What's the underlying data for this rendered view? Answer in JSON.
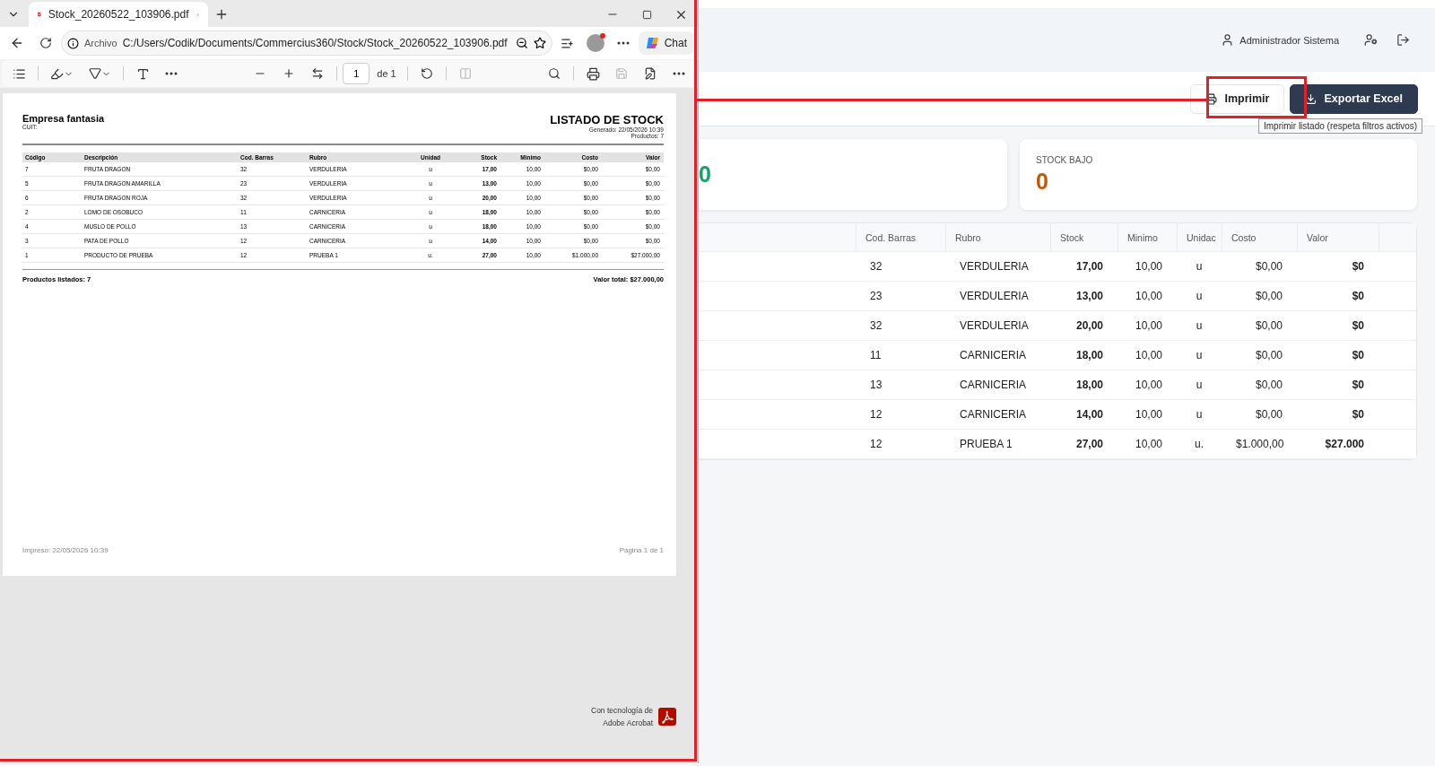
{
  "browser": {
    "tab_title": "Stock_20260522_103906.pdf",
    "address_label": "Archivo",
    "url": "C:/Users/Codik/Documents/Commercius360/Stock/Stock_20260522_103906.pdf",
    "chat_label": "Chat",
    "page_input": "1",
    "page_total": "de 1"
  },
  "pdf": {
    "company": "Empresa fantasia",
    "cuit": "CUIT:",
    "title": "LISTADO DE STOCK",
    "generated": "Generado: 22/05/2026 10:39",
    "count": "Productos: 7",
    "columns": [
      "Código",
      "Descripción",
      "Cod. Barras",
      "Rubro",
      "Unidad",
      "Stock",
      "Minimo",
      "Costo",
      "Valor"
    ],
    "rows": [
      [
        "7",
        "FRUTA DRAGON",
        "32",
        "VERDULERIA",
        "u",
        "17,00",
        "10,00",
        "$0,00",
        "$0,00"
      ],
      [
        "5",
        "FRUTA DRAGON AMARILLA",
        "23",
        "VERDULERIA",
        "u",
        "13,00",
        "10,00",
        "$0,00",
        "$0,00"
      ],
      [
        "6",
        "FRUTA DRAGON ROJA",
        "32",
        "VERDULERIA",
        "u",
        "20,00",
        "10,00",
        "$0,00",
        "$0,00"
      ],
      [
        "2",
        "LOMO DE OSOBUCO",
        "11",
        "CARNICERIA",
        "u",
        "18,00",
        "10,00",
        "$0,00",
        "$0,00"
      ],
      [
        "4",
        "MUSLO DE POLLO",
        "13",
        "CARNICERIA",
        "u",
        "18,00",
        "10,00",
        "$0,00",
        "$0,00"
      ],
      [
        "3",
        "PATA DE POLLO",
        "12",
        "CARNICERIA",
        "u",
        "14,00",
        "10,00",
        "$0,00",
        "$0,00"
      ],
      [
        "1",
        "PRODUCTO DE PRUEBA",
        "12",
        "PRUEBA 1",
        "u.",
        "27,00",
        "10,00",
        "$1.000,00",
        "$27.000,00"
      ]
    ],
    "summary_left": "Productos listados: 7",
    "summary_right": "Valor total: $27.000,00",
    "printed": "Impreso: 22/05/2026 10:39",
    "page_label": "Página 1 de 1",
    "branding": [
      "Con tecnología de",
      "Adobe Acrobat"
    ]
  },
  "app": {
    "user": "Administrador Sistema",
    "buttons": [
      {
        "label": "Imprimir",
        "kind": "outline"
      },
      {
        "label": "Exportar Excel",
        "kind": "primary"
      }
    ],
    "tooltip": "Imprimir listado (respeta filtros activos)",
    "cards": [
      {
        "value": "0",
        "color": "#16a06a"
      },
      {
        "label": "STOCK BAJO",
        "value": "0",
        "color": "#c2590a"
      }
    ],
    "columns": [
      "Cod. Barras",
      "Rubro",
      "Stock",
      "Minimo",
      "Unidac",
      "Costo",
      "Valor"
    ],
    "rows": [
      [
        "32",
        "VERDULERIA",
        "17,00",
        "10,00",
        "u",
        "$0,00",
        "$0"
      ],
      [
        "23",
        "VERDULERIA",
        "13,00",
        "10,00",
        "u",
        "$0,00",
        "$0"
      ],
      [
        "32",
        "VERDULERIA",
        "20,00",
        "10,00",
        "u",
        "$0,00",
        "$0"
      ],
      [
        "11",
        "CARNICERIA",
        "18,00",
        "10,00",
        "u",
        "$0,00",
        "$0"
      ],
      [
        "13",
        "CARNICERIA",
        "18,00",
        "10,00",
        "u",
        "$0,00",
        "$0"
      ],
      [
        "12",
        "CARNICERIA",
        "14,00",
        "10,00",
        "u",
        "$0,00",
        "$0"
      ],
      [
        "12",
        "PRUEBA 1",
        "27,00",
        "10,00",
        "u.",
        "$1.000,00",
        "$27.000"
      ]
    ]
  }
}
